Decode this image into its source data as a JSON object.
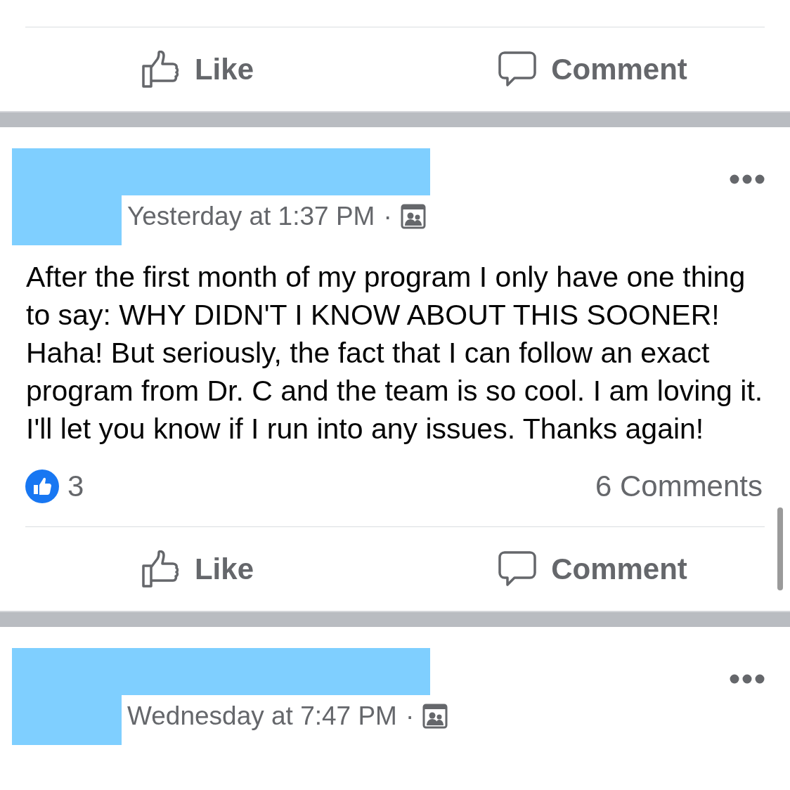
{
  "feed": [
    {
      "actions": [
        {
          "kind": "like",
          "label": "Like"
        },
        {
          "kind": "comment",
          "label": "Comment"
        }
      ]
    },
    {
      "timestamp": "Yesterday at 1:37 PM",
      "separator": "·",
      "body": "After the first month of my program I only have one thing to say: WHY DIDN'T I KNOW ABOUT THIS SOONER! Haha! But seriously, the fact that I can follow an exact program from Dr. C and the team is so cool. I am loving it. I'll let you know if I run into any issues. Thanks again!",
      "reaction_count": "3",
      "comments_count": "6 Comments",
      "actions": [
        {
          "kind": "like",
          "label": "Like"
        },
        {
          "kind": "comment",
          "label": "Comment"
        }
      ]
    },
    {
      "timestamp": "Wednesday at 7:47 PM",
      "separator": "·"
    }
  ]
}
